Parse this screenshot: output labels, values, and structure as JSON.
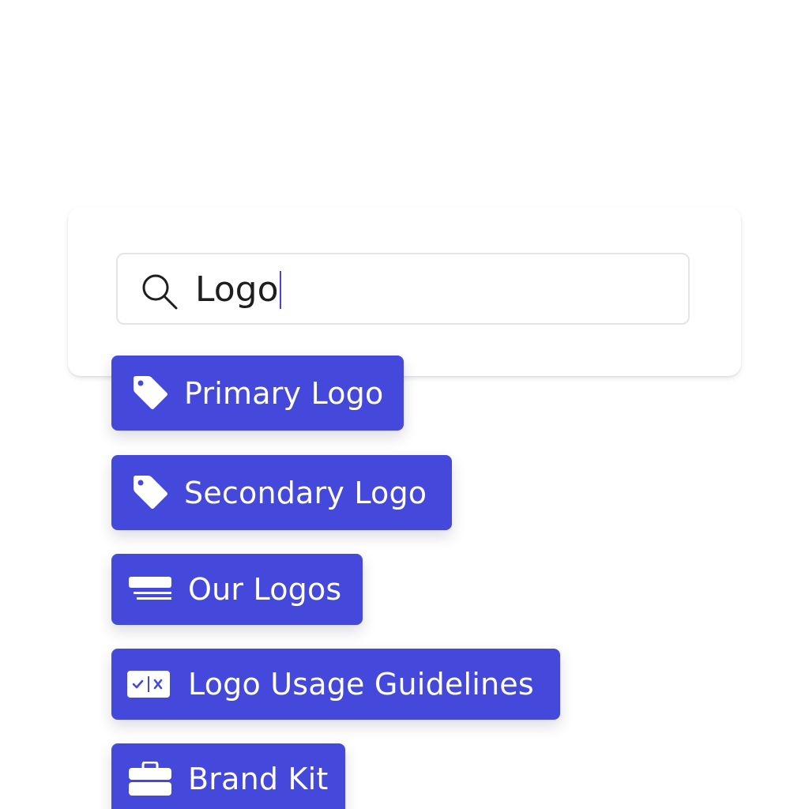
{
  "search": {
    "query": "Logo",
    "icon": "search-icon"
  },
  "results": [
    {
      "label": "Primary Logo",
      "icon": "tag-icon"
    },
    {
      "label": "Secondary Logo",
      "icon": "tag-icon"
    },
    {
      "label": "Our Logos",
      "icon": "stacked-lines-icon"
    },
    {
      "label": "Logo Usage Guidelines",
      "icon": "do-dont-icon"
    },
    {
      "label": "Brand Kit",
      "icon": "briefcase-icon"
    }
  ],
  "colors": {
    "accent": "#4449dc",
    "text": "#1e1e1e",
    "border": "#e4e4e4"
  }
}
